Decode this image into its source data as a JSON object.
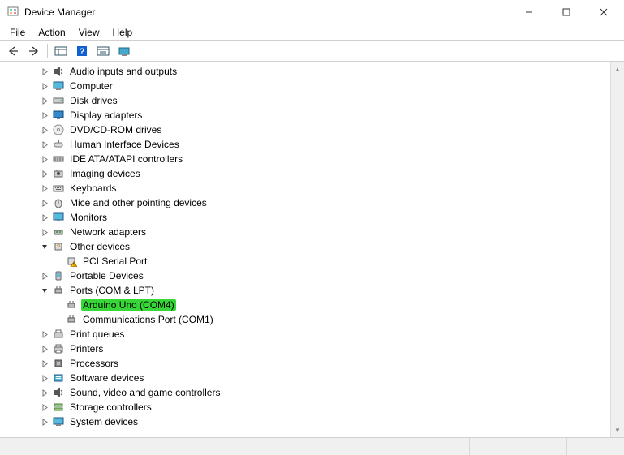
{
  "window": {
    "title": "Device Manager"
  },
  "menu": [
    "File",
    "Action",
    "View",
    "Help"
  ],
  "tree": [
    {
      "label": "Audio inputs and outputs",
      "expanded": false,
      "level": 2,
      "icon": "audio"
    },
    {
      "label": "Computer",
      "expanded": false,
      "level": 2,
      "icon": "computer"
    },
    {
      "label": "Disk drives",
      "expanded": false,
      "level": 2,
      "icon": "disk"
    },
    {
      "label": "Display adapters",
      "expanded": false,
      "level": 2,
      "icon": "display"
    },
    {
      "label": "DVD/CD-ROM drives",
      "expanded": false,
      "level": 2,
      "icon": "dvd"
    },
    {
      "label": "Human Interface Devices",
      "expanded": false,
      "level": 2,
      "icon": "hid"
    },
    {
      "label": "IDE ATA/ATAPI controllers",
      "expanded": false,
      "level": 2,
      "icon": "ide"
    },
    {
      "label": "Imaging devices",
      "expanded": false,
      "level": 2,
      "icon": "imaging"
    },
    {
      "label": "Keyboards",
      "expanded": false,
      "level": 2,
      "icon": "keyboard"
    },
    {
      "label": "Mice and other pointing devices",
      "expanded": false,
      "level": 2,
      "icon": "mouse"
    },
    {
      "label": "Monitors",
      "expanded": false,
      "level": 2,
      "icon": "monitor"
    },
    {
      "label": "Network adapters",
      "expanded": false,
      "level": 2,
      "icon": "network"
    },
    {
      "label": "Other devices",
      "expanded": true,
      "level": 2,
      "icon": "other"
    },
    {
      "label": "PCI Serial Port",
      "expanded": null,
      "level": 3,
      "icon": "warn"
    },
    {
      "label": "Portable Devices",
      "expanded": false,
      "level": 2,
      "icon": "portable"
    },
    {
      "label": "Ports (COM & LPT)",
      "expanded": true,
      "level": 2,
      "icon": "port"
    },
    {
      "label": "Arduino Uno (COM4)",
      "expanded": null,
      "level": 3,
      "icon": "port",
      "highlight": true
    },
    {
      "label": "Communications Port (COM1)",
      "expanded": null,
      "level": 3,
      "icon": "port"
    },
    {
      "label": "Print queues",
      "expanded": false,
      "level": 2,
      "icon": "printqueue"
    },
    {
      "label": "Printers",
      "expanded": false,
      "level": 2,
      "icon": "printer"
    },
    {
      "label": "Processors",
      "expanded": false,
      "level": 2,
      "icon": "cpu"
    },
    {
      "label": "Software devices",
      "expanded": false,
      "level": 2,
      "icon": "software"
    },
    {
      "label": "Sound, video and game controllers",
      "expanded": false,
      "level": 2,
      "icon": "sound"
    },
    {
      "label": "Storage controllers",
      "expanded": false,
      "level": 2,
      "icon": "storage"
    },
    {
      "label": "System devices",
      "expanded": false,
      "level": 2,
      "icon": "system"
    }
  ]
}
